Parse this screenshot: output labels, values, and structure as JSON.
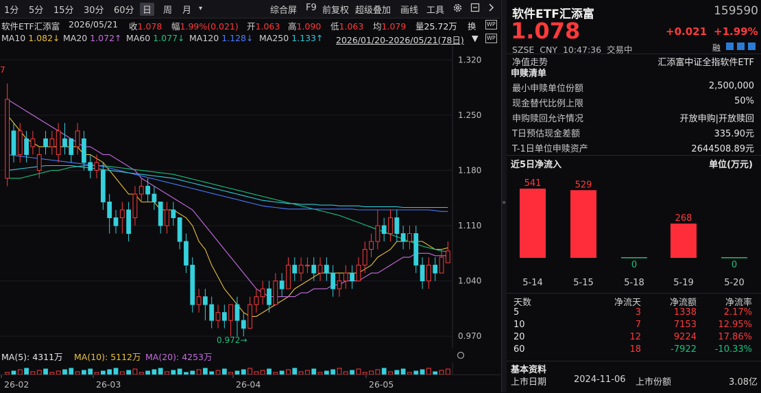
{
  "toolbar": {
    "left_items": [
      "1分",
      "5分",
      "15分",
      "30分",
      "60分",
      "日",
      "周",
      "月",
      "▾"
    ],
    "active": "日",
    "right_items": [
      "综合屏",
      "F9",
      "前复权",
      "超级叠加",
      "画线",
      "工具"
    ],
    "gear_icon": "gear-icon",
    "more_icon": "chevron-right-icon"
  },
  "info": {
    "name": "软件ETF汇添富",
    "date": "2026/05/21",
    "close_label": "收",
    "close": "1.078",
    "amp_label": "幅",
    "amp": "1.99%(0.021)",
    "open_label": "开",
    "open": "1.063",
    "high_label": "高",
    "high": "1.090",
    "low_label": "低",
    "low": "1.063",
    "avg_label": "均",
    "avg": "1.079",
    "vol_label": "量",
    "vol": "25.72万",
    "turn_label": "换",
    "wp_badge": "WP"
  },
  "ma": {
    "ma10": {
      "label": "MA10",
      "value": "1.082↓"
    },
    "ma20": {
      "label": "MA20",
      "value": "1.072↑"
    },
    "ma60": {
      "label": "MA60",
      "value": "1.077↓"
    },
    "ma120": {
      "label": "MA120",
      "value": "1.128↓"
    },
    "ma250": {
      "label": "MA250",
      "value": "1.133↑"
    },
    "range": "2026/01/20-2026/05/21(78日)"
  },
  "chart_data": {
    "type": "candlestick",
    "y_ticks": [
      "1.320",
      "1.250",
      "1.180",
      "1.110",
      "1.040",
      "0.970"
    ],
    "y_range": [
      0.958,
      1.335
    ],
    "low_annotation": "0.972",
    "top_left_mark": "7",
    "x_labels": [
      "26-02",
      "26-03",
      "26-04",
      "26-05"
    ],
    "candles": [
      [
        1.17,
        1.27,
        1.29,
        1.16
      ],
      [
        1.23,
        1.2,
        1.24,
        1.19
      ],
      [
        1.2,
        1.23,
        1.24,
        1.19
      ],
      [
        1.22,
        1.2,
        1.23,
        1.19
      ],
      [
        1.21,
        1.22,
        1.23,
        1.2
      ],
      [
        1.18,
        1.2,
        1.21,
        1.17
      ],
      [
        1.22,
        1.21,
        1.23,
        1.2
      ],
      [
        1.21,
        1.22,
        1.23,
        1.2
      ],
      [
        1.2,
        1.23,
        1.24,
        1.19
      ],
      [
        1.22,
        1.21,
        1.24,
        1.2
      ],
      [
        1.22,
        1.2,
        1.22,
        1.19
      ],
      [
        1.21,
        1.23,
        1.24,
        1.2
      ],
      [
        1.22,
        1.19,
        1.23,
        1.18
      ],
      [
        1.19,
        1.18,
        1.2,
        1.17
      ],
      [
        1.18,
        1.19,
        1.2,
        1.17
      ],
      [
        1.18,
        1.14,
        1.19,
        1.13
      ],
      [
        1.14,
        1.12,
        1.15,
        1.1
      ],
      [
        1.12,
        1.11,
        1.13,
        1.1
      ],
      [
        1.12,
        1.13,
        1.14,
        1.1
      ],
      [
        1.13,
        1.1,
        1.14,
        1.09
      ],
      [
        1.12,
        1.15,
        1.16,
        1.11
      ],
      [
        1.15,
        1.16,
        1.17,
        1.14
      ],
      [
        1.16,
        1.15,
        1.17,
        1.14
      ],
      [
        1.15,
        1.14,
        1.16,
        1.13
      ],
      [
        1.14,
        1.11,
        1.14,
        1.1
      ],
      [
        1.11,
        1.13,
        1.14,
        1.1
      ],
      [
        1.13,
        1.12,
        1.14,
        1.11
      ],
      [
        1.12,
        1.09,
        1.12,
        1.08
      ],
      [
        1.09,
        1.06,
        1.1,
        1.05
      ],
      [
        1.06,
        1.01,
        1.07,
        1.0
      ],
      [
        1.01,
        1.02,
        1.03,
        1.0
      ],
      [
        1.02,
        1.01,
        1.03,
        0.99
      ],
      [
        1.01,
        0.99,
        1.02,
        0.98
      ],
      [
        0.99,
        1.0,
        1.01,
        0.98
      ],
      [
        1.0,
        0.99,
        1.01,
        0.98
      ],
      [
        0.99,
        1.01,
        1.01,
        0.97
      ],
      [
        1.01,
        0.99,
        1.02,
        0.97
      ],
      [
        0.99,
        0.98,
        1.0,
        0.97
      ],
      [
        0.98,
        1.01,
        1.02,
        0.98
      ],
      [
        1.01,
        1.02,
        1.03,
        1.0
      ],
      [
        1.02,
        1.03,
        1.04,
        1.01
      ],
      [
        1.03,
        1.01,
        1.04,
        1.0
      ],
      [
        1.01,
        1.04,
        1.05,
        1.01
      ],
      [
        1.04,
        1.03,
        1.05,
        1.02
      ],
      [
        1.03,
        1.06,
        1.07,
        1.03
      ],
      [
        1.06,
        1.05,
        1.07,
        1.04
      ],
      [
        1.05,
        1.06,
        1.07,
        1.04
      ],
      [
        1.06,
        1.06,
        1.07,
        1.05
      ],
      [
        1.06,
        1.05,
        1.07,
        1.04
      ],
      [
        1.05,
        1.06,
        1.07,
        1.04
      ],
      [
        1.06,
        1.05,
        1.07,
        1.04
      ],
      [
        1.05,
        1.03,
        1.06,
        1.02
      ],
      [
        1.03,
        1.04,
        1.05,
        1.02
      ],
      [
        1.04,
        1.05,
        1.06,
        1.03
      ],
      [
        1.05,
        1.04,
        1.06,
        1.03
      ],
      [
        1.04,
        1.06,
        1.07,
        1.04
      ],
      [
        1.06,
        1.08,
        1.09,
        1.05
      ],
      [
        1.08,
        1.09,
        1.1,
        1.07
      ],
      [
        1.09,
        1.11,
        1.13,
        1.08
      ],
      [
        1.11,
        1.1,
        1.12,
        1.09
      ],
      [
        1.1,
        1.12,
        1.13,
        1.09
      ],
      [
        1.12,
        1.1,
        1.13,
        1.09
      ],
      [
        1.1,
        1.09,
        1.11,
        1.08
      ],
      [
        1.09,
        1.1,
        1.11,
        1.08
      ],
      [
        1.1,
        1.06,
        1.11,
        1.05
      ],
      [
        1.06,
        1.04,
        1.07,
        1.03
      ],
      [
        1.04,
        1.06,
        1.07,
        1.03
      ],
      [
        1.06,
        1.05,
        1.07,
        1.04
      ],
      [
        1.05,
        1.07,
        1.08,
        1.05
      ],
      [
        1.063,
        1.078,
        1.09,
        1.063
      ]
    ],
    "series": [
      {
        "name": "MA10",
        "color": "#e8c13a",
        "values": [
          1.25,
          1.24,
          1.23,
          1.22,
          1.215,
          1.21,
          1.21,
          1.21,
          1.21,
          1.21,
          1.21,
          1.21,
          1.2,
          1.2,
          1.195,
          1.19,
          1.18,
          1.17,
          1.16,
          1.15,
          1.15,
          1.14,
          1.14,
          1.14,
          1.13,
          1.13,
          1.13,
          1.125,
          1.12,
          1.11,
          1.09,
          1.08,
          1.06,
          1.045,
          1.03,
          1.02,
          1.01,
          1.0,
          0.995,
          0.995,
          1.0,
          1.005,
          1.01,
          1.015,
          1.02,
          1.03,
          1.035,
          1.04,
          1.045,
          1.05,
          1.05,
          1.05,
          1.05,
          1.05,
          1.05,
          1.05,
          1.055,
          1.06,
          1.07,
          1.075,
          1.08,
          1.09,
          1.09,
          1.09,
          1.09,
          1.09,
          1.085,
          1.08,
          1.08,
          1.082
        ]
      },
      {
        "name": "MA20",
        "color": "#c86ce0",
        "values": [
          1.27,
          1.265,
          1.26,
          1.255,
          1.25,
          1.245,
          1.24,
          1.235,
          1.23,
          1.225,
          1.22,
          1.215,
          1.21,
          1.21,
          1.205,
          1.2,
          1.2,
          1.195,
          1.19,
          1.185,
          1.18,
          1.17,
          1.165,
          1.16,
          1.155,
          1.15,
          1.145,
          1.14,
          1.135,
          1.13,
          1.12,
          1.11,
          1.1,
          1.09,
          1.08,
          1.07,
          1.06,
          1.05,
          1.04,
          1.03,
          1.025,
          1.02,
          1.02,
          1.02,
          1.02,
          1.02,
          1.025,
          1.025,
          1.03,
          1.03,
          1.03,
          1.035,
          1.035,
          1.04,
          1.04,
          1.04,
          1.045,
          1.05,
          1.05,
          1.055,
          1.06,
          1.065,
          1.07,
          1.07,
          1.075,
          1.075,
          1.075,
          1.072,
          1.072,
          1.072
        ]
      },
      {
        "name": "MA60",
        "color": "#19c37d",
        "values": [
          1.17,
          1.17,
          1.17,
          1.172,
          1.174,
          1.176,
          1.178,
          1.18,
          1.18,
          1.182,
          1.184,
          1.185,
          1.186,
          1.186,
          1.186,
          1.186,
          1.185,
          1.184,
          1.183,
          1.182,
          1.181,
          1.18,
          1.179,
          1.178,
          1.177,
          1.176,
          1.175,
          1.173,
          1.171,
          1.169,
          1.167,
          1.165,
          1.163,
          1.161,
          1.159,
          1.157,
          1.155,
          1.153,
          1.151,
          1.149,
          1.147,
          1.145,
          1.143,
          1.141,
          1.139,
          1.137,
          1.135,
          1.133,
          1.131,
          1.129,
          1.127,
          1.125,
          1.123,
          1.12,
          1.117,
          1.114,
          1.111,
          1.108,
          1.105,
          1.102,
          1.099,
          1.096,
          1.093,
          1.09,
          1.087,
          1.084,
          1.082,
          1.08,
          1.078,
          1.077
        ]
      },
      {
        "name": "MA120",
        "color": "#4a7bff",
        "values": [
          1.2,
          1.199,
          1.198,
          1.197,
          1.196,
          1.195,
          1.194,
          1.193,
          1.192,
          1.191,
          1.19,
          1.189,
          1.188,
          1.187,
          1.186,
          1.185,
          1.183,
          1.181,
          1.179,
          1.177,
          1.175,
          1.173,
          1.171,
          1.169,
          1.167,
          1.165,
          1.163,
          1.161,
          1.159,
          1.157,
          1.155,
          1.153,
          1.151,
          1.149,
          1.147,
          1.145,
          1.143,
          1.141,
          1.139,
          1.137,
          1.135,
          1.134,
          1.133,
          1.132,
          1.131,
          1.131,
          1.131,
          1.131,
          1.131,
          1.131,
          1.131,
          1.131,
          1.131,
          1.131,
          1.131,
          1.13,
          1.13,
          1.13,
          1.13,
          1.13,
          1.13,
          1.13,
          1.13,
          1.13,
          1.13,
          1.13,
          1.13,
          1.129,
          1.128,
          1.128
        ]
      },
      {
        "name": "MA250",
        "color": "#35c8d8",
        "values": [
          1.18,
          1.181,
          1.182,
          1.183,
          1.184,
          1.185,
          1.186,
          1.186,
          1.186,
          1.186,
          1.186,
          1.185,
          1.184,
          1.183,
          1.182,
          1.181,
          1.18,
          1.179,
          1.178,
          1.177,
          1.176,
          1.175,
          1.174,
          1.173,
          1.172,
          1.171,
          1.17,
          1.168,
          1.166,
          1.164,
          1.162,
          1.16,
          1.158,
          1.156,
          1.154,
          1.152,
          1.15,
          1.148,
          1.146,
          1.144,
          1.142,
          1.141,
          1.14,
          1.139,
          1.138,
          1.138,
          1.137,
          1.137,
          1.137,
          1.136,
          1.136,
          1.136,
          1.135,
          1.135,
          1.135,
          1.135,
          1.134,
          1.134,
          1.134,
          1.134,
          1.134,
          1.134,
          1.133,
          1.133,
          1.133,
          1.133,
          1.133,
          1.133,
          1.133,
          1.133
        ]
      }
    ]
  },
  "volume": {
    "ma5": {
      "label": "MA(5):",
      "value": "4311万"
    },
    "ma10": {
      "label": "MA(10):",
      "value": "5112万"
    },
    "ma20": {
      "label": "MA(20):",
      "value": "4253万"
    }
  },
  "right": {
    "title": "软件ETF汇添富",
    "code": "159590",
    "price": "1.078",
    "change": "+0.021",
    "change_pct": "+1.99%",
    "meta": "SZSE  CNY  10:47:36  交易中",
    "margin_badge": "融",
    "nav": {
      "k": "净值走势",
      "v": "汇添富中证全指软件ETF"
    },
    "subs_title": "申赎清单",
    "subs": [
      {
        "k": "最小申赎单位份额",
        "v": "2,500,000"
      },
      {
        "k": "现金替代比例上限",
        "v": "50%"
      },
      {
        "k": "申购赎回允许情况",
        "v": "开放申购|开放赎回"
      },
      {
        "k": "T日预估现金差额",
        "v": "335.90元"
      },
      {
        "k": "T-1日单位申赎资产",
        "v": "2644508.89元"
      }
    ],
    "flow_title": "近5日净流入",
    "flow_unit": "单位(万元)",
    "flow_chart": {
      "type": "bar",
      "categories": [
        "5-14",
        "5-15",
        "5-18",
        "5-19",
        "5-20"
      ],
      "values": [
        541,
        529,
        0,
        268,
        0
      ],
      "labels": [
        "541",
        "529",
        "0",
        "268",
        "0"
      ]
    },
    "table": {
      "headers": [
        "天数",
        "净流天",
        "净流额",
        "净流率"
      ],
      "rows": [
        [
          "5",
          "3",
          "1338",
          "2.17%"
        ],
        [
          "10",
          "7",
          "7153",
          "12.95%"
        ],
        [
          "20",
          "12",
          "9224",
          "17.86%"
        ],
        [
          "60",
          "18",
          "-7922",
          "-10.33%"
        ]
      ]
    },
    "basic_title": "基本资料",
    "basic": [
      {
        "k": "上市日期",
        "v": "2024-11-06",
        "k2": "上市份额",
        "v2": "3.08亿"
      }
    ]
  }
}
